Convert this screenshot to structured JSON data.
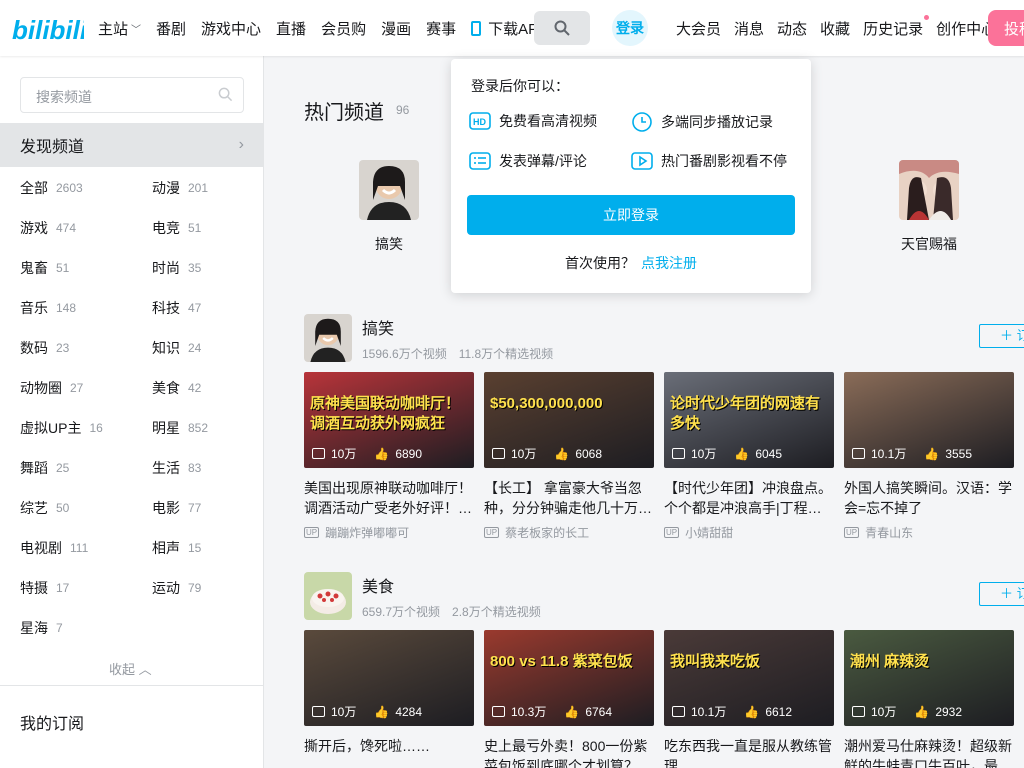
{
  "colors": {
    "brand_blue": "#00aeec",
    "brand_pink": "#fb7299"
  },
  "header": {
    "nav": [
      {
        "label": "主站",
        "icon": "chevron-down-icon"
      },
      {
        "label": "番剧"
      },
      {
        "label": "游戏中心"
      },
      {
        "label": "直播"
      },
      {
        "label": "会员购"
      },
      {
        "label": "漫画"
      },
      {
        "label": "赛事"
      }
    ],
    "download_label": "下载APP",
    "login_label": "登录",
    "right_nav": [
      "大会员",
      "消息",
      "动态",
      "收藏",
      "历史记录",
      "创作中心"
    ],
    "upload_label": "投稿"
  },
  "sidebar": {
    "search_placeholder": "搜索频道",
    "discover_label": "发现频道",
    "categories": [
      {
        "label": "全部",
        "count": "2603"
      },
      {
        "label": "动漫",
        "count": "201"
      },
      {
        "label": "游戏",
        "count": "474"
      },
      {
        "label": "电竞",
        "count": "51"
      },
      {
        "label": "鬼畜",
        "count": "51"
      },
      {
        "label": "时尚",
        "count": "35"
      },
      {
        "label": "音乐",
        "count": "148"
      },
      {
        "label": "科技",
        "count": "47"
      },
      {
        "label": "数码",
        "count": "23"
      },
      {
        "label": "知识",
        "count": "24"
      },
      {
        "label": "动物圈",
        "count": "27"
      },
      {
        "label": "美食",
        "count": "42"
      },
      {
        "label": "虚拟UP主",
        "count": "16"
      },
      {
        "label": "明星",
        "count": "852"
      },
      {
        "label": "舞蹈",
        "count": "25"
      },
      {
        "label": "生活",
        "count": "83"
      },
      {
        "label": "综艺",
        "count": "50"
      },
      {
        "label": "电影",
        "count": "77"
      },
      {
        "label": "电视剧",
        "count": "111"
      },
      {
        "label": "相声",
        "count": "15"
      },
      {
        "label": "特摄",
        "count": "17"
      },
      {
        "label": "运动",
        "count": "79"
      },
      {
        "label": "星海",
        "count": "7"
      }
    ],
    "collapse_label": "收起",
    "my_subscriptions": "我的订阅"
  },
  "main": {
    "hot_title": "热门频道",
    "hot_count": "96",
    "hot_channels": [
      {
        "name": "搞笑"
      },
      {
        "name": "天官赐福"
      }
    ],
    "sections": [
      {
        "name": "搞笑",
        "videos_count": "1596.6万个视频",
        "featured_count": "11.8万个精选视频",
        "subscribe_label": "订",
        "videos": [
          {
            "title": "美国出现原神联动咖啡厅！调酒活动广受老外好评！…",
            "views": "10万",
            "likes": "6890",
            "up": "蹦蹦炸弹嘟嘟可",
            "thumb_text": "原神美国联动咖啡厅！调酒互动获外网疯狂",
            "bg": "#b8343a"
          },
          {
            "title": "【长工】 拿富豪大爷当忽种，分分钟骗走他几十万…",
            "views": "10万",
            "likes": "6068",
            "up": "蔡老板家的长工",
            "thumb_text": "$50,300,000,000",
            "bg": "#5a4030"
          },
          {
            "title": "【时代少年团】冲浪盘点。个个都是冲浪高手|丁程…",
            "views": "10万",
            "likes": "6045",
            "up": "小婧甜甜",
            "thumb_text": "论时代少年团的网速有多快",
            "bg": "#6a6e78"
          },
          {
            "title": "外国人搞笑瞬间。汉语：学会=忘不掉了",
            "views": "10.1万",
            "likes": "3555",
            "up": "青春山东",
            "thumb_text": "",
            "bg": "#8a6c58"
          }
        ]
      },
      {
        "name": "美食",
        "videos_count": "659.7万个视频",
        "featured_count": "2.8万个精选视频",
        "subscribe_label": "订",
        "videos": [
          {
            "title": "撕开后，馋死啦……",
            "views": "10万",
            "likes": "4284",
            "up": "",
            "thumb_text": "",
            "bg": "#5a4a3c"
          },
          {
            "title": "史上最亏外卖！800一份紫菜包饭到底哪个才划算？",
            "views": "10.3万",
            "likes": "6764",
            "up": "",
            "thumb_text": "800 vs 11.8 紫菜包饭",
            "bg": "#9a3a2e"
          },
          {
            "title": "吃东西我一直是服从教练管理",
            "views": "10.1万",
            "likes": "6612",
            "up": "",
            "thumb_text": "我叫我来吃饭",
            "bg": "#4a3a38"
          },
          {
            "title": "潮州爱马仕麻辣烫！超级新鲜的牛蛙青口牛百叶，最…",
            "views": "10万",
            "likes": "2932",
            "up": "",
            "thumb_text": "潮州 麻辣烫",
            "bg": "#4a5a40"
          }
        ]
      }
    ]
  },
  "login_popup": {
    "title": "登录后你可以：",
    "benefits": [
      {
        "label": "免费看高清视频",
        "icon": "hd-icon"
      },
      {
        "label": "多端同步播放记录",
        "icon": "clock-icon"
      },
      {
        "label": "发表弹幕/评论",
        "icon": "comment-list-icon"
      },
      {
        "label": "热门番剧影视看不停",
        "icon": "play-icon"
      }
    ],
    "login_button": "立即登录",
    "first_time": "首次使用？",
    "register_link": "点我注册"
  }
}
